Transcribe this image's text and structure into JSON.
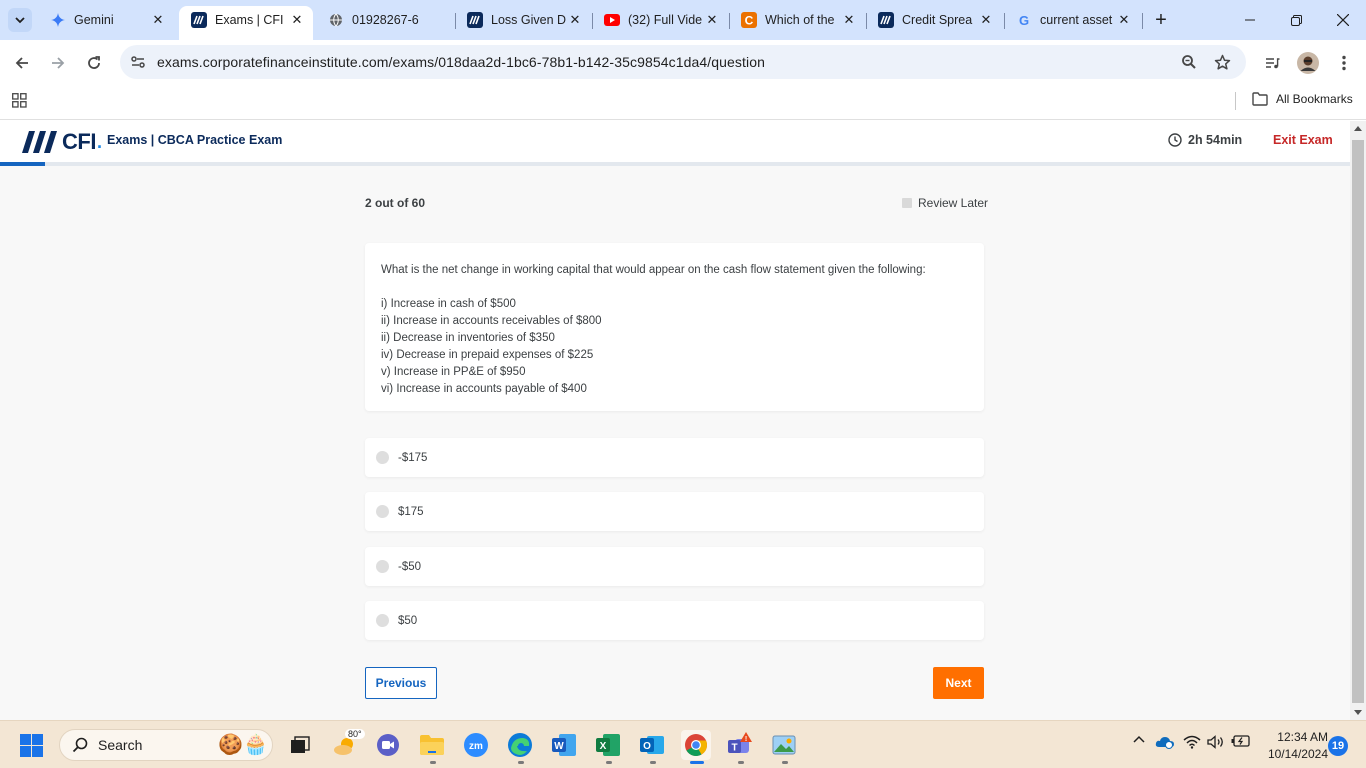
{
  "browser": {
    "tabs": [
      {
        "title": "Gemini",
        "favicon": "gemini-icon",
        "active": false
      },
      {
        "title": "Exams | CFI",
        "favicon": "cfi-icon",
        "active": true
      },
      {
        "title": "01928267-6",
        "favicon": "globe-icon",
        "active": false
      },
      {
        "title": "Loss Given D",
        "favicon": "cfi-icon",
        "active": false
      },
      {
        "title": "(32) Full Vide",
        "favicon": "youtube-icon",
        "active": false
      },
      {
        "title": "Which of the",
        "favicon": "chegg-icon",
        "active": false
      },
      {
        "title": "Credit Sprea",
        "favicon": "cfi-icon",
        "active": false
      },
      {
        "title": "current asset",
        "favicon": "google-icon",
        "active": false
      }
    ],
    "url": "exams.corporatefinanceinstitute.com/exams/018daa2d-1bc6-78b1-b142-35c9854c1da4/question",
    "bookmarks_label": "All Bookmarks"
  },
  "exam": {
    "logo_text": "CFI",
    "title": "Exams | CBCA Practice Exam",
    "time_remaining": "2h 54min",
    "exit_label": "Exit Exam",
    "progress_fraction": 0.033,
    "counter": "2 out of 60",
    "review_label": "Review Later",
    "question": {
      "lead": "What is the net change in working capital that would appear on the cash flow statement given the following:",
      "items": [
        "i) Increase in cash of $500",
        "ii) Increase in accounts receivables of $800",
        "ii) Decrease in inventories of $350",
        "iv) Decrease in prepaid expenses of $225",
        "v) Increase in PP&E of $950",
        "vi) Increase in accounts payable of $400"
      ]
    },
    "options": [
      "-$175",
      "$175",
      "-$50",
      "$50"
    ],
    "prev_label": "Previous",
    "next_label": "Next",
    "colors": {
      "brand_navy": "#0b2a5b",
      "accent_blue": "#1565c0",
      "next_orange": "#ff6f00",
      "exit_red": "#c62828"
    }
  },
  "taskbar": {
    "search_placeholder": "Search",
    "weather_temp": "80°",
    "time": "12:34 AM",
    "date": "10/14/2024",
    "notifications": "19"
  }
}
